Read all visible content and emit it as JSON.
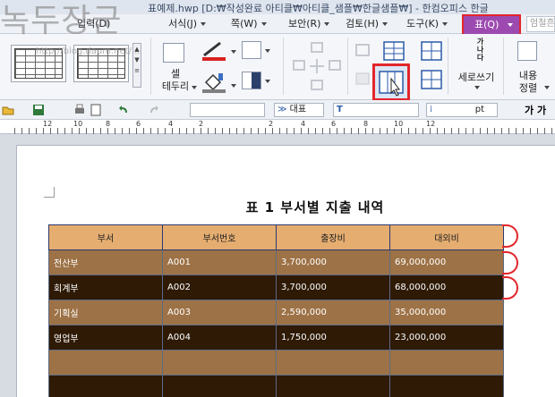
{
  "window": {
    "title": "표예제.hwp [D:₩작성완료 아티클₩아티클_샘플₩한글샘플₩] - 한컴오피스 한글",
    "watermark": "녹두장군",
    "watermark_url": "http://blog.daum.net/..."
  },
  "menu": {
    "items": [
      {
        "label": "입력(D)",
        "name": "menu-insert"
      },
      {
        "label": "서식(J)",
        "name": "menu-format"
      },
      {
        "label": "쪽(W)",
        "name": "menu-page"
      },
      {
        "label": "보안(R)",
        "name": "menu-security"
      },
      {
        "label": "검토(H)",
        "name": "menu-review"
      },
      {
        "label": "도구(K)",
        "name": "menu-tools"
      }
    ],
    "table_tab": "표(Q)",
    "right_field": "엄철흔"
  },
  "ribbon": {
    "cell_border_label_1": "셀",
    "cell_border_label_2": "테두리",
    "vertical_text_label": "세로쓰기",
    "vertical_text_icon": "가나다",
    "content_align_label_1": "내용",
    "content_align_label_2": "정렬"
  },
  "format_bar": {
    "style_value": "대표",
    "size_unit": "pt",
    "bold_italic": "가 가"
  },
  "ruler": {
    "numbers": [
      "12",
      "10",
      "8",
      "6",
      "4",
      "2",
      "2",
      "4",
      "6",
      "8",
      "10",
      "12"
    ]
  },
  "document": {
    "title": "표 1 부서별 지출 내역",
    "table": {
      "headers": [
        "부서",
        "부서번호",
        "출장비",
        "대외비"
      ],
      "rows": [
        [
          "전산부",
          "A001",
          "3,700,000",
          "69,000,000"
        ],
        [
          "회계부",
          "A002",
          "3,700,000",
          "68,000,000"
        ],
        [
          "기획실",
          "A003",
          "2,590,000",
          "35,000,000"
        ],
        [
          "영업부",
          "A004",
          "1,750,000",
          "23,000,000"
        ],
        [
          "",
          "",
          "",
          ""
        ],
        [
          "",
          "",
          "",
          ""
        ]
      ]
    }
  },
  "colors": {
    "table_tab_bg": "#9d4ab0",
    "highlight_red": "#e3262b",
    "header_bg": "#e5ad70",
    "row_light": "#9d7246",
    "row_dark": "#2e1a05"
  }
}
